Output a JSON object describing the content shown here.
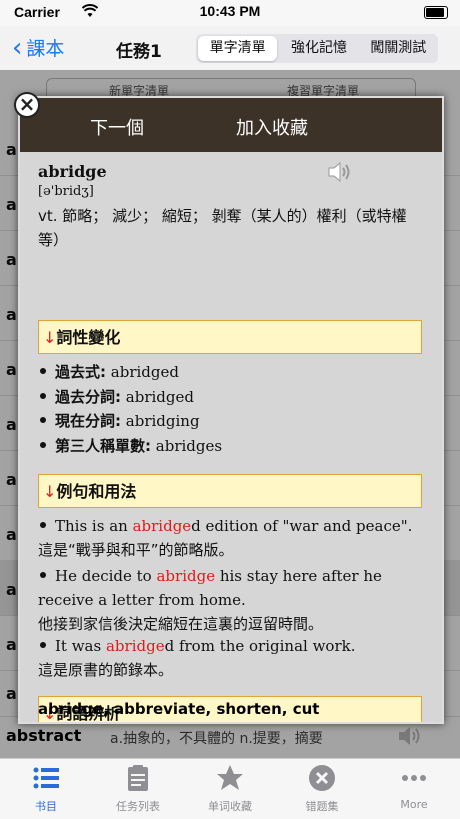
{
  "status": {
    "carrier": "Carrier",
    "time": "10:43 PM"
  },
  "nav": {
    "back_label": "課本",
    "title": "任務1",
    "segments": [
      "單字清單",
      "強化記憶",
      "闖關測試"
    ],
    "active_segment": 0
  },
  "subtabs": [
    "新單字清單",
    "複習單字清單"
  ],
  "background_list": {
    "row_letter": "a",
    "next_word": "abstract",
    "next_meaning": "a.抽象的，不具體的 n.提要，摘要"
  },
  "popup": {
    "next_label": "下一個",
    "favorite_label": "加入收藏",
    "word": "abridge",
    "phonetic": "[ə'bridʒ]",
    "definition": "vt. 節略；  減少；  縮短；  剝奪（某人的）權利（或特權等）",
    "sections": {
      "forms_title": "詞性變化",
      "examples_title": "例句和用法",
      "synonyms_title": "詞語辨析",
      "arrow": "↓"
    },
    "forms": [
      {
        "label": "過去式:",
        "value": "abridged"
      },
      {
        "label": "過去分詞:",
        "value": "abridged"
      },
      {
        "label": "現在分詞:",
        "value": "abridging"
      },
      {
        "label": "第三人稱單數:",
        "value": "abridges"
      }
    ],
    "examples": [
      {
        "pre": "This is an ",
        "hl": "abridge",
        "post": "d edition of \"war and peace\".",
        "cn": "這是“戰爭與和平”的節略版。"
      },
      {
        "pre": "He decide to ",
        "hl": "abridge",
        "post": " his stay here after he receive a letter from home.",
        "cn": "他接到家信後決定縮短在這裏的逗留時間。"
      },
      {
        "pre": "It was ",
        "hl": "abridge",
        "post": "d from the original work.",
        "cn": "這是原書的節錄本。"
      }
    ],
    "synonyms": "abridge, abbreviate, shorten, cut"
  },
  "tabbar": [
    {
      "label": "书目",
      "icon": "list-icon"
    },
    {
      "label": "任务列表",
      "icon": "clipboard-icon"
    },
    {
      "label": "单词收藏",
      "icon": "star-icon"
    },
    {
      "label": "错题集",
      "icon": "error-x-icon"
    },
    {
      "label": "More",
      "icon": "more-dots-icon"
    }
  ],
  "colors": {
    "accent": "#1878f2",
    "highlight": "#e01b1b",
    "header": "#3c3227",
    "section_bg": "#fff7c6",
    "section_border": "#e2a33a",
    "tab_active": "#2a6bd8"
  }
}
